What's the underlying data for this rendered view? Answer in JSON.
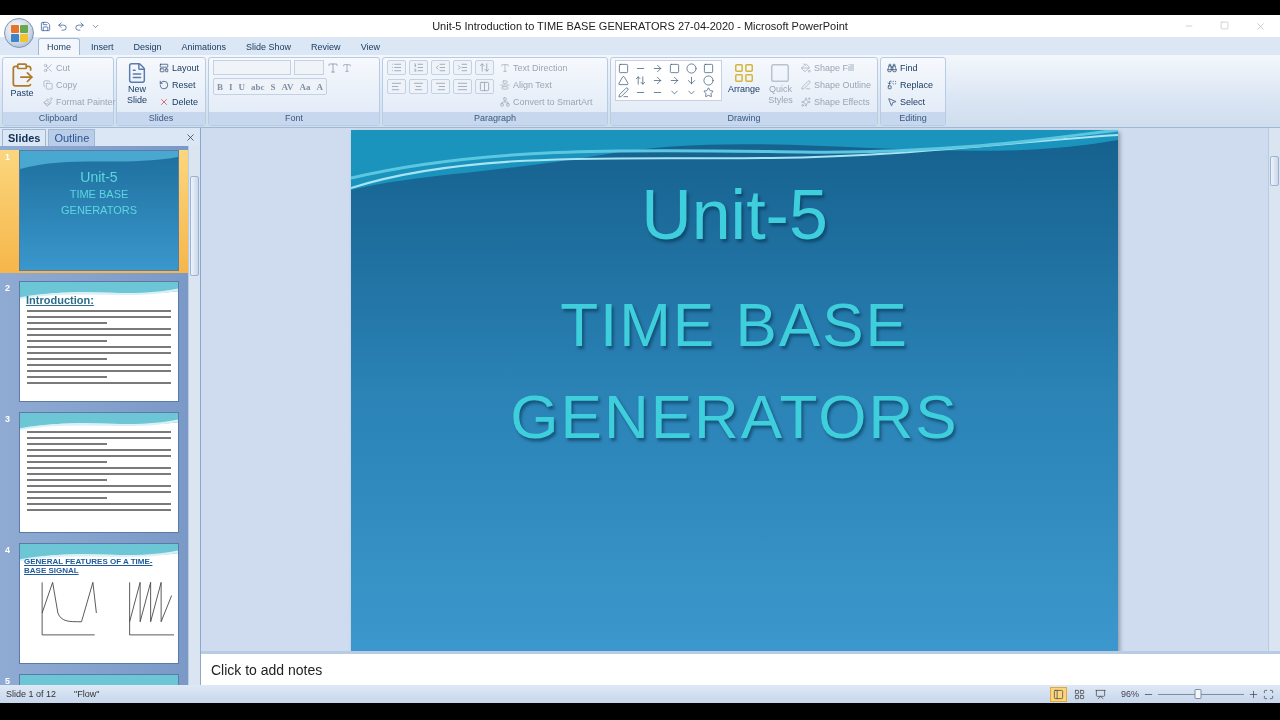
{
  "window": {
    "title": "Unit-5 Introduction to TIME BASE GENERATORS  27-04-2020 - Microsoft PowerPoint"
  },
  "ribbon_tabs": [
    {
      "label": "Home",
      "selected": true
    },
    {
      "label": "Insert",
      "selected": false
    },
    {
      "label": "Design",
      "selected": false
    },
    {
      "label": "Animations",
      "selected": false
    },
    {
      "label": "Slide Show",
      "selected": false
    },
    {
      "label": "Review",
      "selected": false
    },
    {
      "label": "View",
      "selected": false
    }
  ],
  "ribbon_groups": [
    {
      "kind": "clipboard",
      "label": "Clipboard",
      "big": {
        "label": "Paste"
      },
      "items": [
        {
          "label": "Cut",
          "disabled": true
        },
        {
          "label": "Copy",
          "disabled": true
        },
        {
          "label": "Format Painter",
          "disabled": true
        }
      ]
    },
    {
      "kind": "slides",
      "label": "Slides",
      "big": {
        "label": "New Slide"
      },
      "items": [
        {
          "label": "Layout",
          "disabled": false
        },
        {
          "label": "Reset",
          "disabled": false
        },
        {
          "label": "Delete",
          "disabled": false
        }
      ]
    },
    {
      "kind": "font",
      "label": "Font",
      "glyphs": [
        "B",
        "I",
        "U",
        "abc",
        "S",
        "AV",
        "Aa",
        "A"
      ]
    },
    {
      "kind": "paragraph",
      "label": "Paragraph",
      "items": [
        {
          "label": "Text Direction",
          "disabled": true
        },
        {
          "label": "Align Text",
          "disabled": true
        },
        {
          "label": "Convert to SmartArt",
          "disabled": true
        }
      ]
    },
    {
      "kind": "drawing",
      "label": "Drawing",
      "big": {
        "label": "Arrange"
      },
      "second": {
        "label": "Quick Styles",
        "disabled": true
      },
      "items": [
        {
          "label": "Shape Fill",
          "disabled": true
        },
        {
          "label": "Shape Outline",
          "disabled": true
        },
        {
          "label": "Shape Effects",
          "disabled": true
        }
      ]
    },
    {
      "kind": "editing",
      "label": "Editing",
      "items": [
        {
          "label": "Find",
          "disabled": false
        },
        {
          "label": "Replace",
          "disabled": false
        },
        {
          "label": "Select",
          "disabled": false
        }
      ]
    }
  ],
  "pane_tabs": [
    {
      "label": "Slides",
      "selected": true
    },
    {
      "label": "Outline",
      "selected": false
    }
  ],
  "thumbnails": [
    {
      "number": "1",
      "kind": "title",
      "selected": true,
      "lines": [
        "Unit-5",
        "TIME BASE",
        "GENERATORS"
      ]
    },
    {
      "number": "2",
      "kind": "text",
      "selected": false,
      "heading": "Introduction:"
    },
    {
      "number": "3",
      "kind": "text",
      "selected": false
    },
    {
      "number": "4",
      "kind": "chart",
      "selected": false,
      "heading": "GENERAL FEATURES OF A TIME-BASE SIGNAL"
    },
    {
      "number": "5",
      "kind": "partial",
      "selected": false
    }
  ],
  "slide": {
    "title": "Unit-5",
    "subtitle_lines": [
      "TIME BASE",
      "GENERATORS"
    ]
  },
  "notes": {
    "placeholder": "Click to add notes"
  },
  "status_bar": {
    "slide": "Slide 1 of 12",
    "theme": "\"Flow\"",
    "views": [
      {
        "kind": "normal",
        "selected": true
      },
      {
        "kind": "sorter",
        "selected": false
      },
      {
        "kind": "show",
        "selected": false
      }
    ],
    "zoom": "96%",
    "zoom_slider": {
      "level": 0.47
    }
  }
}
